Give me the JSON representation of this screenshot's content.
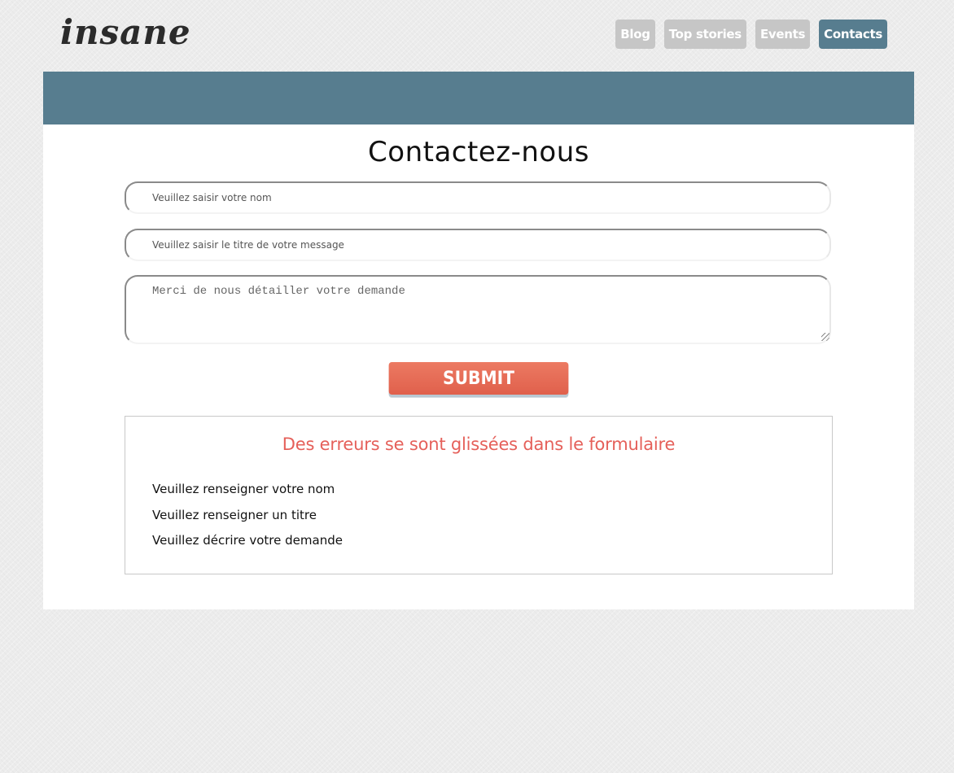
{
  "brand": {
    "logo_text": "insane"
  },
  "nav": {
    "items": [
      {
        "label": "Blog",
        "active": false
      },
      {
        "label": "Top stories",
        "active": false
      },
      {
        "label": "Events",
        "active": false
      },
      {
        "label": "Contacts",
        "active": true
      }
    ]
  },
  "colors": {
    "accent": "#577d8f",
    "nav_inactive": "#c6c6c6",
    "submit": "#e6664f",
    "error_title": "#e5605a"
  },
  "form": {
    "title": "Contactez-nous",
    "name_placeholder": "Veuillez saisir votre nom",
    "name_value": "",
    "subject_placeholder": "Veuillez saisir le titre de votre message",
    "subject_value": "",
    "message_placeholder": "Merci de nous détailler votre demande",
    "message_value": "",
    "submit_label": "SUBMIT"
  },
  "errors": {
    "title": "Des erreurs se sont glissées dans le formulaire",
    "items": [
      "Veuillez renseigner votre nom",
      "Veuillez renseigner un titre",
      "Veuillez décrire votre demande"
    ]
  }
}
